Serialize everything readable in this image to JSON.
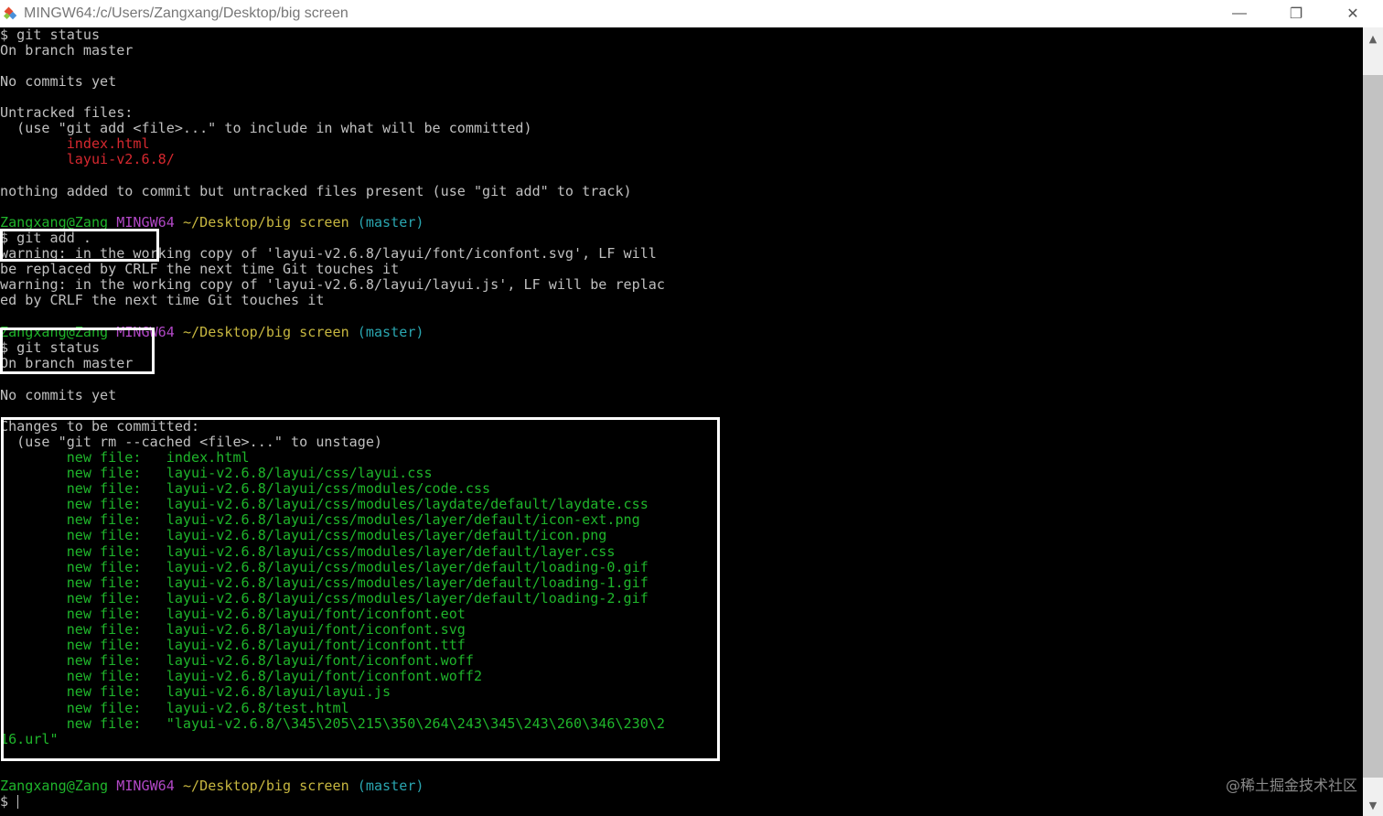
{
  "window": {
    "title": "MINGW64:/c/Users/Zangxang/Desktop/big screen",
    "minimize": "—",
    "restore": "❐",
    "close": "✕"
  },
  "colors": {
    "prompt_user": "#1fb52b",
    "prompt_shell": "#b148c6",
    "prompt_path": "#c7b740",
    "prompt_branch": "#2aa6b0",
    "untracked": "#d6282f",
    "staged": "#1fb52b"
  },
  "terminal": {
    "l0": "$ git status",
    "l1": "On branch master",
    "l2": "No commits yet",
    "l3": "Untracked files:",
    "l4": "  (use \"git add <file>...\" to include in what will be committed)",
    "l5": "        index.html",
    "l6": "        layui-v2.6.8/",
    "l7": "nothing added to commit but untracked files present (use \"git add\" to track)",
    "prompt": {
      "user": "Zangxang@Zang",
      "shell": "MINGW64",
      "path": "~/Desktop/big screen",
      "branch": "(master)"
    },
    "l9": "$ git add .",
    "l10": "warning: in the working copy of 'layui-v2.6.8/layui/font/iconfont.svg', LF will",
    "l11": "be replaced by CRLF the next time Git touches it",
    "l12": "warning: in the working copy of 'layui-v2.6.8/layui/layui.js', LF will be replac",
    "l13": "ed by CRLF the next time Git touches it",
    "l15": "$ git status",
    "l16": "On branch master",
    "l17": "No commits yet",
    "l18": "Changes to be committed:",
    "l19": "  (use \"git rm --cached <file>...\" to unstage)",
    "new_files": [
      "        new file:   index.html",
      "        new file:   layui-v2.6.8/layui/css/layui.css",
      "        new file:   layui-v2.6.8/layui/css/modules/code.css",
      "        new file:   layui-v2.6.8/layui/css/modules/laydate/default/laydate.css",
      "        new file:   layui-v2.6.8/layui/css/modules/layer/default/icon-ext.png",
      "        new file:   layui-v2.6.8/layui/css/modules/layer/default/icon.png",
      "        new file:   layui-v2.6.8/layui/css/modules/layer/default/layer.css",
      "        new file:   layui-v2.6.8/layui/css/modules/layer/default/loading-0.gif",
      "        new file:   layui-v2.6.8/layui/css/modules/layer/default/loading-1.gif",
      "        new file:   layui-v2.6.8/layui/css/modules/layer/default/loading-2.gif",
      "        new file:   layui-v2.6.8/layui/font/iconfont.eot",
      "        new file:   layui-v2.6.8/layui/font/iconfont.svg",
      "        new file:   layui-v2.6.8/layui/font/iconfont.ttf",
      "        new file:   layui-v2.6.8/layui/font/iconfont.woff",
      "        new file:   layui-v2.6.8/layui/font/iconfont.woff2",
      "        new file:   layui-v2.6.8/layui/layui.js",
      "        new file:   layui-v2.6.8/test.html",
      "        new file:   \"layui-v2.6.8/\\345\\205\\215\\350\\264\\243\\345\\243\\260\\346\\230\\2",
      "16.url\""
    ],
    "final_prompt_symbol": "$"
  },
  "scrollbar": {
    "up": "▲",
    "down": "▼"
  },
  "watermark": "@稀土掘金技术社区"
}
